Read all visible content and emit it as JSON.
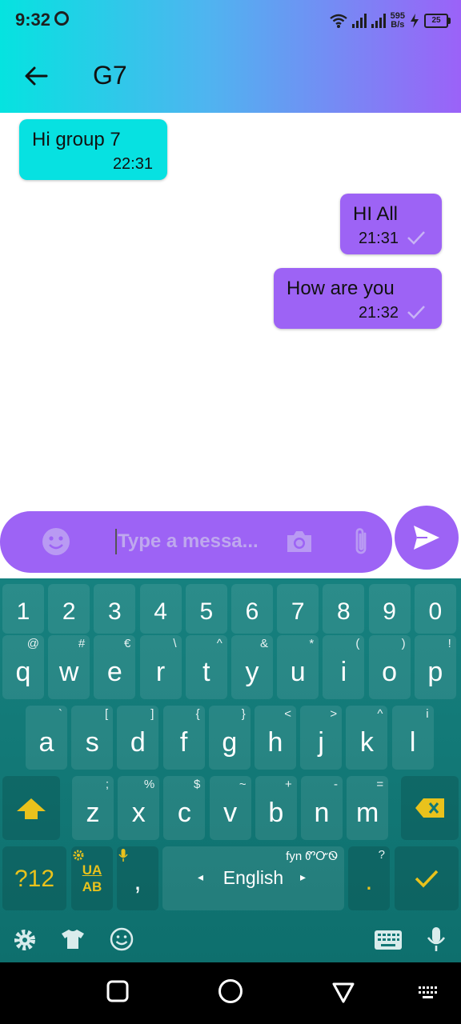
{
  "status_bar": {
    "time": "9:32",
    "net_speed": "595",
    "net_unit": "B/s",
    "battery": "25"
  },
  "header": {
    "title": "G7"
  },
  "messages": [
    {
      "text": "Hi group 7",
      "time": "22:31"
    },
    {
      "text": "HI All",
      "time": "21:31"
    },
    {
      "text": "How are you",
      "time": "21:32"
    }
  ],
  "composer": {
    "placeholder": "Type a messa..."
  },
  "keyboard": {
    "numbers": [
      "1",
      "2",
      "3",
      "4",
      "5",
      "6",
      "7",
      "8",
      "9",
      "0"
    ],
    "row1": [
      {
        "k": "q",
        "a": "@"
      },
      {
        "k": "w",
        "a": "#"
      },
      {
        "k": "e",
        "a": "€"
      },
      {
        "k": "r",
        "a": "\\"
      },
      {
        "k": "t",
        "a": "^"
      },
      {
        "k": "y",
        "a": "&"
      },
      {
        "k": "u",
        "a": "*"
      },
      {
        "k": "i",
        "a": "("
      },
      {
        "k": "o",
        "a": ")"
      },
      {
        "k": "p",
        "a": "!"
      }
    ],
    "row2": [
      {
        "k": "a",
        "a": "`"
      },
      {
        "k": "s",
        "a": "["
      },
      {
        "k": "d",
        "a": "]"
      },
      {
        "k": "f",
        "a": "{"
      },
      {
        "k": "g",
        "a": "}"
      },
      {
        "k": "h",
        "a": "<"
      },
      {
        "k": "j",
        "a": ">"
      },
      {
        "k": "k",
        "a": "^"
      },
      {
        "k": "l",
        "a": "i"
      }
    ],
    "row3": [
      {
        "k": "z",
        "a": ";"
      },
      {
        "k": "x",
        "a": "%"
      },
      {
        "k": "c",
        "a": "$"
      },
      {
        "k": "v",
        "a": "~"
      },
      {
        "k": "b",
        "a": "+"
      },
      {
        "k": "n",
        "a": "-"
      },
      {
        "k": "m",
        "a": "="
      }
    ],
    "symbols_key": "?12",
    "layout_key_top": "UA",
    "layout_key_bottom": "AB",
    "comma": ",",
    "period": ".",
    "period_alt": "?",
    "space_label": "English",
    "space_alt": "fyn ᏛᏅᏫ",
    "space_left_arrow": "◂",
    "space_right_arrow": "▸",
    "accent_color": "#e9c21c"
  }
}
